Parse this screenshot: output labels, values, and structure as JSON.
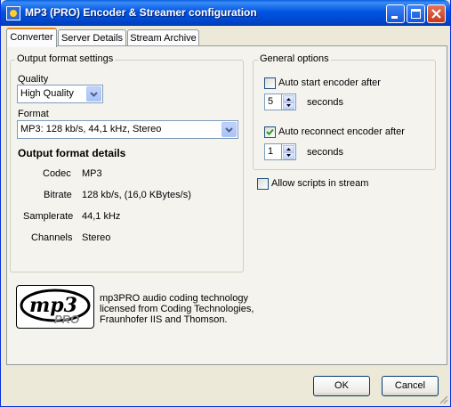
{
  "window": {
    "title": "MP3 (PRO) Encoder & Streamer configuration"
  },
  "tabs": [
    {
      "label": "Converter",
      "active": true
    },
    {
      "label": "Server Details",
      "active": false
    },
    {
      "label": "Stream Archive",
      "active": false
    }
  ],
  "output_format": {
    "group_title": "Output format settings",
    "quality_label": "Quality",
    "quality_value": "High Quality",
    "format_label": "Format",
    "format_value": "MP3: 128 kb/s, 44,1 kHz, Stereo",
    "details_title": "Output format details",
    "details": [
      {
        "label": "Codec",
        "value": "MP3"
      },
      {
        "label": "Bitrate",
        "value": "128 kb/s, (16,0 KBytes/s)"
      },
      {
        "label": "Samplerate",
        "value": "44,1 kHz"
      },
      {
        "label": "Channels",
        "value": "Stereo"
      }
    ]
  },
  "general": {
    "group_title": "General options",
    "auto_start_label": "Auto start encoder after",
    "auto_start_checked": false,
    "auto_start_value": "5",
    "auto_start_unit": "seconds",
    "auto_reconnect_label": "Auto reconnect encoder after",
    "auto_reconnect_checked": true,
    "auto_reconnect_value": "1",
    "auto_reconnect_unit": "seconds",
    "allow_scripts_label": "Allow scripts in stream",
    "allow_scripts_checked": false
  },
  "logo": {
    "main": "mp3",
    "sub": "PRO"
  },
  "credit": {
    "lines": [
      "mp3PRO audio coding technology",
      "licensed from Coding Technologies,",
      "Fraunhofer IIS and Thomson."
    ]
  },
  "buttons": {
    "ok": "OK",
    "cancel": "Cancel"
  }
}
